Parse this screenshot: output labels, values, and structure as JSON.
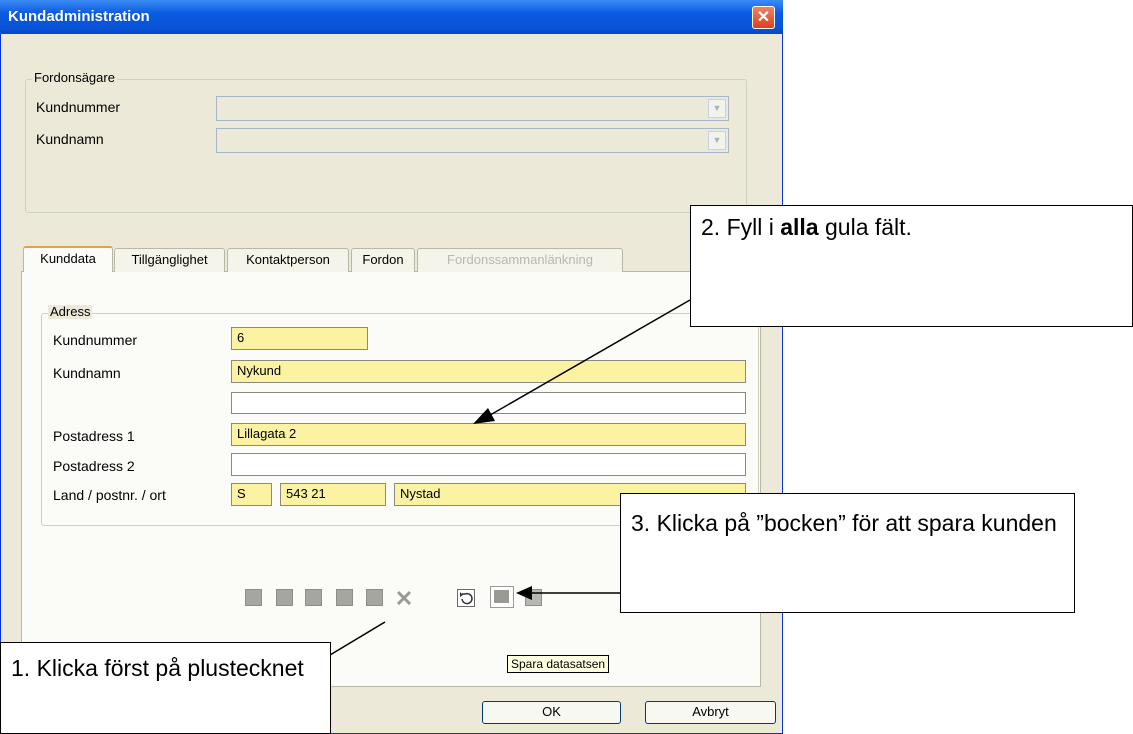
{
  "window": {
    "title": "Kundadministration",
    "close_glyph": "✕"
  },
  "owner": {
    "group_label": "Fordonsägare",
    "customer_number_label": "Kundnummer",
    "customer_name_label": "Kundnamn"
  },
  "tabs": [
    "Kunddata",
    "Tillgänglighet",
    "Kontaktperson",
    "Fordon",
    "Fordonssammanlänkning"
  ],
  "address": {
    "group_label": "Adress",
    "customer_number_label": "Kundnummer",
    "customer_number_value": "6",
    "customer_name_label": "Kundnamn",
    "customer_name_value": "Nykund",
    "name2_value": "",
    "postal1_label": "Postadress 1",
    "postal1_value": "Lillagata 2",
    "postal2_label": "Postadress 2",
    "postal2_value": "",
    "country_label": "Land / postnr. / ort",
    "country_value": "S",
    "zip_value": "543 21",
    "city_value": "Nystad"
  },
  "tooltip": "Spara datasatsen",
  "buttons": {
    "ok": "OK",
    "cancel": "Avbryt"
  },
  "callouts": {
    "c1": "1. Klicka först på plustecknet",
    "c2_pre": "2. Fyll i ",
    "c2_bold": "alla",
    "c2_post": " gula fält.",
    "c3": "3. Klicka på ”bocken” för att spara kunden"
  },
  "icons": [
    "first-record-icon",
    "prev-record-icon",
    "next-record-icon",
    "last-record-icon",
    "add-icon",
    "delete-icon",
    "undo-icon",
    "save-check-icon",
    "cancel-icon"
  ]
}
